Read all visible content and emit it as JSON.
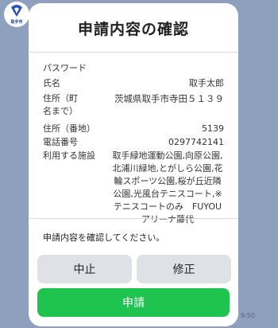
{
  "sender": {
    "caption": "取手市"
  },
  "dialog": {
    "title": "申請内容の確認",
    "rows": [
      {
        "label": "パスワード",
        "value": ""
      },
      {
        "label": "氏名",
        "value": "取手太郎"
      },
      {
        "label": "住所（町名まで）",
        "value": "茨城県取手市寺田５１３９"
      },
      {
        "label": "住所（番地）",
        "value": "5139"
      },
      {
        "label": "電話番号",
        "value": "0297742141"
      },
      {
        "label": "利用する施設",
        "value": "取手緑地運動公園,向原公園,北浦川緑地,とがしら公園,花輪スポーツ公園,桜が丘近隣公園,光風台テニスコート,※テニスコートのみ　FUYOUアリーナ藤代"
      }
    ],
    "confirm_text": "申請内容を確認してください。",
    "buttons": {
      "cancel": "中止",
      "edit": "修正",
      "submit": "申請"
    }
  },
  "timestamp": "9:50",
  "colors": {
    "background": "#8fa0be",
    "submit": "#1fc44f",
    "secondary_button": "#dfe1e6"
  }
}
